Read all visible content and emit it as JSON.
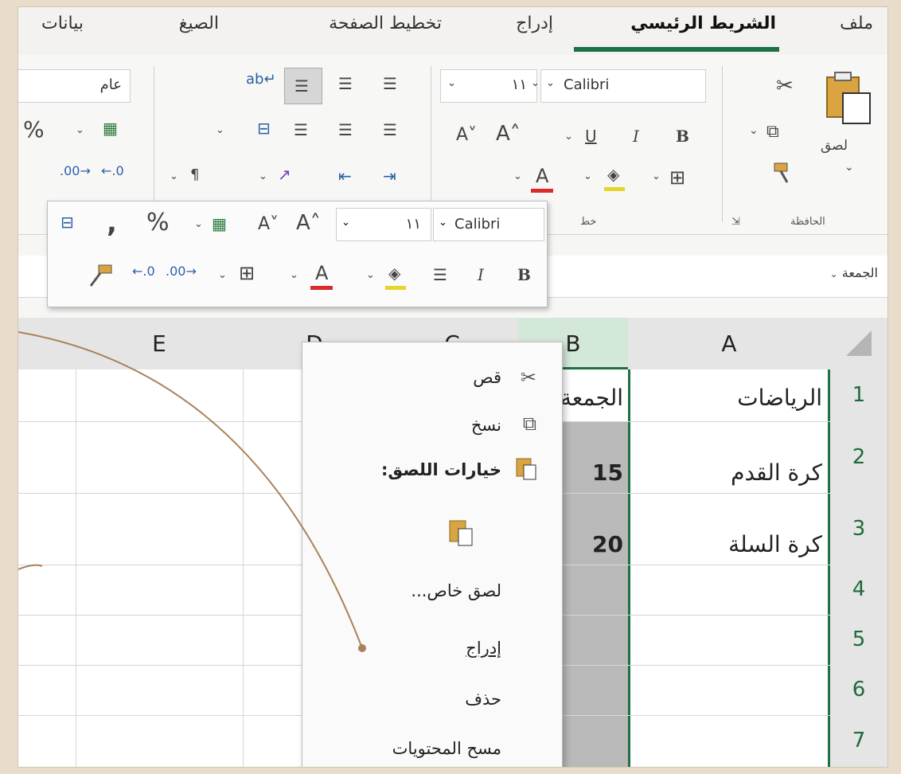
{
  "menu": {
    "tabs": [
      {
        "label": "ملف"
      },
      {
        "label": "الشريط الرئيسي"
      },
      {
        "label": "إدراج"
      },
      {
        "label": "تخطيط الصفحة"
      },
      {
        "label": "الصيغ"
      },
      {
        "label": "بيانات"
      }
    ],
    "active_tab": "الشريط الرئيسي"
  },
  "ribbon": {
    "clipboard": {
      "paste_label": "لصق",
      "group_label": "الحافظة"
    },
    "font": {
      "name": "Calibri",
      "size": "١١",
      "group_label": "خط"
    },
    "number": {
      "format": "عام"
    }
  },
  "formula_bar": {
    "name_box": "الجمعة"
  },
  "mini_toolbar": {
    "font_name": "Calibri",
    "font_size": "١١"
  },
  "sheet": {
    "columns": [
      "A",
      "B",
      "C",
      "D",
      "E"
    ],
    "rows": [
      "1",
      "2",
      "3",
      "4",
      "5",
      "6",
      "7"
    ],
    "cells": {
      "A1": "الرياضات",
      "B1": "الجمعة",
      "A2": "كرة القدم",
      "B2": "15",
      "A3": "كرة السلة",
      "B3": "20"
    }
  },
  "context_menu": {
    "items": [
      {
        "label": "قص",
        "icon": "scissors-icon"
      },
      {
        "label": "نسخ",
        "icon": "copy-icon"
      },
      {
        "label": "خيارات اللصق:",
        "icon": "paste-icon"
      },
      {
        "label": "",
        "icon": "paste-option-icon"
      },
      {
        "label": "لصق خاص..."
      },
      {
        "label": "إدراج"
      },
      {
        "label": "حذف"
      },
      {
        "label": "مسح المحتويات"
      }
    ]
  },
  "colors": {
    "accent": "#1e7145",
    "selection": "#b9b9b9",
    "background": "#e9dccb"
  }
}
